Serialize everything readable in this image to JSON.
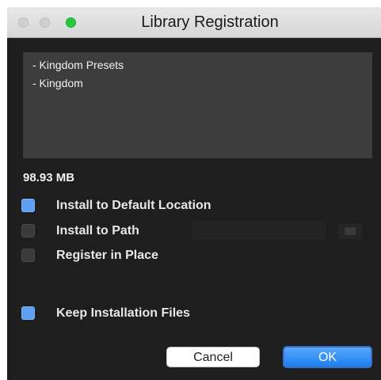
{
  "window": {
    "title": "Library Registration"
  },
  "library_list": {
    "items": [
      "- Kingdom Presets",
      "- Kingdom"
    ]
  },
  "size_label": "98.93 MB",
  "options": {
    "install_default": {
      "label": "Install to Default Location",
      "checked": true
    },
    "install_path": {
      "label": "Install to Path",
      "checked": false,
      "path_value": ""
    },
    "register_in_place": {
      "label": "Register in Place",
      "checked": false
    },
    "keep_files": {
      "label": "Keep Installation Files",
      "checked": true
    }
  },
  "buttons": {
    "cancel": "Cancel",
    "ok": "OK"
  },
  "colors": {
    "accent": "#5e9ff2",
    "ok_button": "#1b7ff3",
    "background": "#1e1e1e"
  }
}
